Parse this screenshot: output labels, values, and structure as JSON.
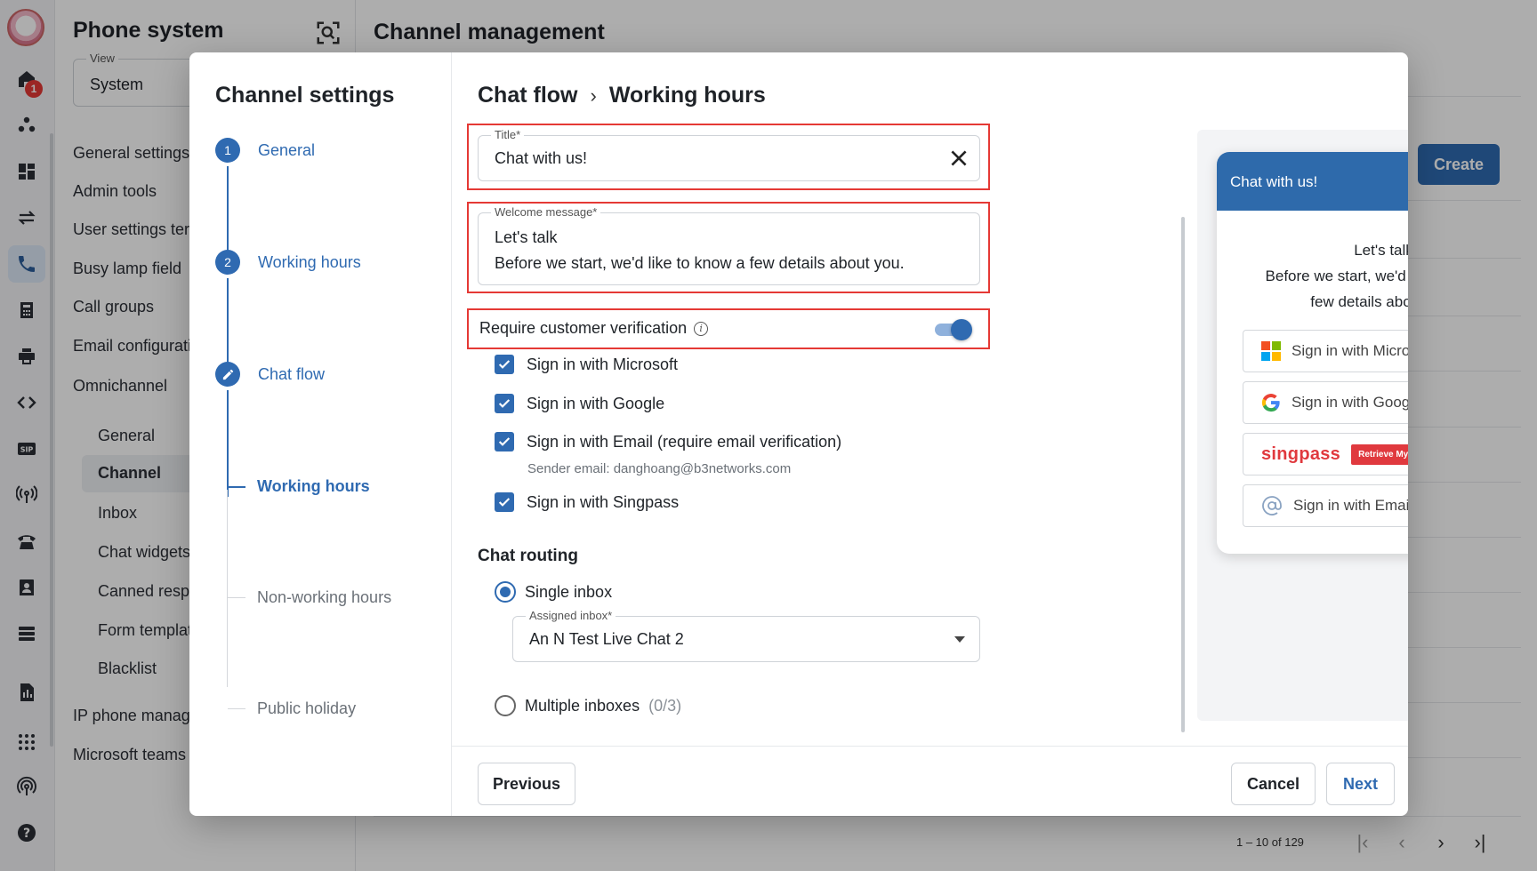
{
  "app": {
    "sidebar_title": "Phone system",
    "view_label": "View",
    "view_value": "System",
    "home_badge": "1",
    "nav_items": [
      "General settings",
      "Admin tools",
      "User settings ter",
      "Busy lamp field",
      "Call groups",
      "Email configurati",
      "Omnichannel"
    ],
    "omnichannel_items": [
      "General",
      "Channel",
      "Inbox",
      "Chat widgets",
      "Canned resp",
      "Form templat",
      "Blacklist"
    ],
    "bottom_items": [
      "IP phone manag",
      "Microsoft teams"
    ],
    "page_title": "Channel management",
    "create_label": "Create",
    "pagination": "1 – 10 of 129",
    "rail_icons": [
      "home-icon",
      "users-icon",
      "dashboard-icon",
      "transfer-icon",
      "phone-settings-icon",
      "calculator-icon",
      "printer-icon",
      "code-icon",
      "sip-icon",
      "broadcast-icon",
      "telephone-icon",
      "contacts-icon",
      "list-icon",
      "report-icon",
      "apps-grid-icon",
      "wireless-icon",
      "help-icon"
    ]
  },
  "modal": {
    "steps_title": "Channel settings",
    "steps": [
      {
        "number": "1",
        "label": "General",
        "state": "done"
      },
      {
        "number": "2",
        "label": "Working hours",
        "state": "done"
      },
      {
        "number": "",
        "label": "Chat flow",
        "state": "editing"
      },
      {
        "label": "Working hours",
        "state": "current"
      },
      {
        "label": "Non-working hours",
        "state": "pending"
      },
      {
        "label": "Public holiday",
        "state": "pending"
      }
    ],
    "breadcrumb": [
      "Chat flow",
      "Working hours"
    ],
    "form": {
      "title_label": "Title*",
      "title_value": "Chat with us!",
      "welcome_label": "Welcome message*",
      "welcome_line1": "Let's talk",
      "welcome_line2": "Before we start, we'd like to know a few details about you.",
      "verification_label": "Require customer verification",
      "verification_on": true,
      "options": [
        {
          "label": "Sign in with Microsoft",
          "checked": true
        },
        {
          "label": "Sign in with Google",
          "checked": true
        },
        {
          "label": "Sign in with Email (require email verification)",
          "checked": true
        },
        {
          "label": "Sign in with Singpass",
          "checked": true
        }
      ],
      "sender_email": "Sender email: danghoang@b3networks.com",
      "routing_title": "Chat routing",
      "single_inbox_label": "Single inbox",
      "assigned_inbox_label": "Assigned inbox*",
      "assigned_inbox_value": "An N Test Live Chat 2",
      "multiple_inbox_label": "Multiple inboxes",
      "multiple_inbox_count": "(0/3)"
    },
    "preview": {
      "title": "Chat with us!",
      "welcome": "Let's talk\nBefore we start, we'd like to know a few details about you.",
      "welcome_line1": "Let's talk",
      "welcome_line2": "Before we start, we'd like to know a",
      "welcome_line3": "few details about you.",
      "microsoft_button": "Sign in with Microsoft",
      "google_button": "Sign in with Google",
      "singpass_logo": "singpass",
      "singpass_badge": "Retrieve Myinfo with singpass",
      "email_button": "Sign in with Email",
      "header_color": "#2e6aab"
    },
    "footer": {
      "previous": "Previous",
      "cancel": "Cancel",
      "next": "Next"
    }
  },
  "colors": {
    "accent": "#2f6ab1",
    "highlight_border": "#e53935",
    "badge": "#e53935"
  }
}
